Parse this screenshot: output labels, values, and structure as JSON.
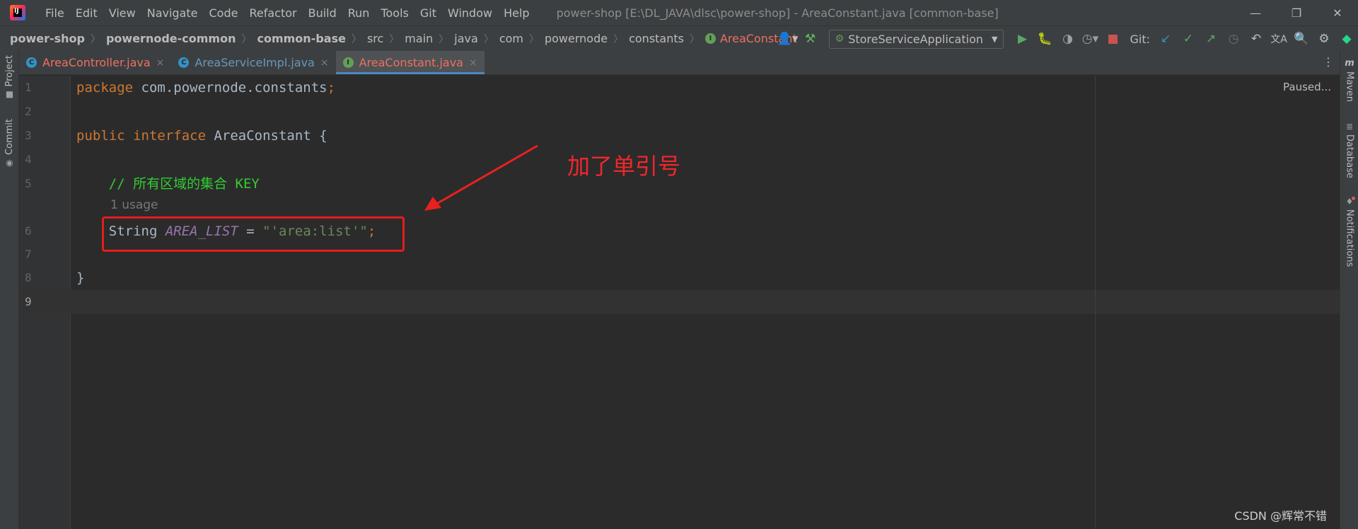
{
  "app": {
    "logo_text": "IJ"
  },
  "menu": [
    "File",
    "Edit",
    "View",
    "Navigate",
    "Code",
    "Refactor",
    "Build",
    "Run",
    "Tools",
    "Git",
    "Window",
    "Help"
  ],
  "window_title": "power-shop [E:\\DL_JAVA\\dlsc\\power-shop] - AreaConstant.java [common-base]",
  "window_controls": {
    "minimize": "—",
    "restore": "❐",
    "close": "✕"
  },
  "breadcrumb": [
    "power-shop",
    "powernode-common",
    "common-base",
    "src",
    "main",
    "java",
    "com",
    "powernode",
    "constants",
    "AreaConstant"
  ],
  "breadcrumb_badge": "I",
  "toolbar": {
    "run_config": "StoreServiceApplication",
    "git_label": "Git:",
    "icons": [
      "user-icon",
      "build-hammer-icon",
      "run-icon",
      "debug-icon",
      "coverage-icon",
      "profile-icon",
      "stop-icon",
      "git-update-icon",
      "git-commit-icon",
      "git-push-icon",
      "history-icon",
      "rollback-icon",
      "translate-icon",
      "search-icon",
      "settings-icon",
      "jetbrains-icon"
    ]
  },
  "left_tools": [
    {
      "label": "Project",
      "icon": "folder-icon"
    },
    {
      "label": "Commit",
      "icon": "commit-icon"
    }
  ],
  "right_tools": [
    {
      "label": "Maven",
      "icon": "maven-icon",
      "glyph": "m"
    },
    {
      "label": "Database",
      "icon": "database-icon",
      "glyph": "≣"
    },
    {
      "label": "Notifications",
      "icon": "bell-icon",
      "glyph": "🔔"
    }
  ],
  "tabs": [
    {
      "label": "AreaController.java",
      "badge": "C",
      "kind": "class"
    },
    {
      "label": "AreaServiceImpl.java",
      "badge": "C",
      "kind": "class"
    },
    {
      "label": "AreaConstant.java",
      "badge": "I",
      "kind": "interface",
      "active": true
    }
  ],
  "tab_close": "×",
  "tabs_more": "⋮",
  "editor": {
    "status": "Paused...",
    "usage_hint": "1 usage",
    "line_numbers": [
      "1",
      "2",
      "3",
      "4",
      "5",
      "6",
      "7",
      "8",
      "9"
    ],
    "code": {
      "l1_kw": "package",
      "l1_pkg": " com.powernode.constants",
      "l1_semi": ";",
      "l3_kw1": "public",
      "l3_kw2": "interface",
      "l3_name": " AreaConstant {",
      "l5_comment1": "    // ",
      "l5_comment_cjk": "所有区域的集合",
      "l5_comment2": " KEY",
      "l6_type": "    String ",
      "l6_const": "AREA_LIST",
      "l6_eq": " = ",
      "l6_str": "\"'area:list'\"",
      "l6_semi": ";",
      "l8_close": "}"
    }
  },
  "annotation": {
    "note": "加了单引号"
  },
  "watermark": "CSDN @辉常不错"
}
